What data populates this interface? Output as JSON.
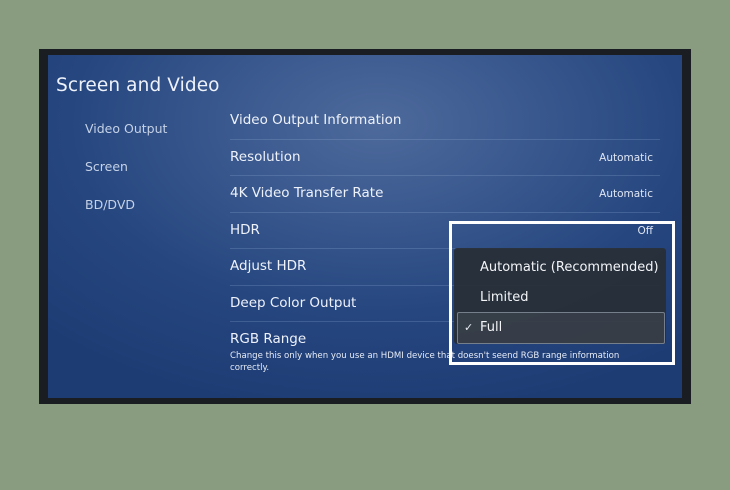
{
  "screen": {
    "title": "Screen and Video",
    "sidebar": {
      "items": [
        {
          "label": "Video Output"
        },
        {
          "label": "Screen"
        },
        {
          "label": "BD/DVD"
        }
      ]
    },
    "settings": [
      {
        "label": "Video Output Information",
        "value": ""
      },
      {
        "label": "Resolution",
        "value": "Automatic"
      },
      {
        "label": "4K Video Transfer Rate",
        "value": "Automatic"
      },
      {
        "label": "HDR",
        "value": "Off"
      },
      {
        "label": "Adjust HDR",
        "value": ""
      },
      {
        "label": "Deep Color Output",
        "value": ""
      },
      {
        "label": "RGB Range",
        "value": "",
        "note": "Change this only when you use an HDMI device that doesn't seend RGB range information correctly."
      }
    ],
    "dropdown": {
      "options": [
        {
          "label": "Automatic (Recommended)"
        },
        {
          "label": "Limited"
        },
        {
          "label": "Full"
        }
      ],
      "selected": "Full",
      "check_icon": "✓"
    }
  },
  "colors": {
    "background": "#8a9c80",
    "screen_accent": "#2a4a84",
    "highlight_border": "#ffffff"
  }
}
